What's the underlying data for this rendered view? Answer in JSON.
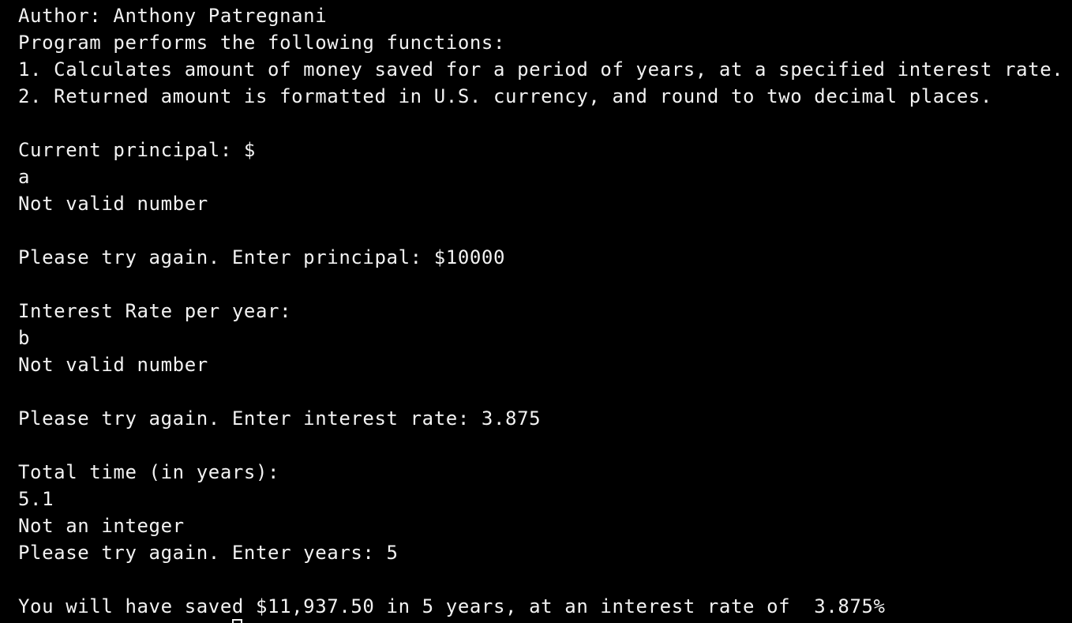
{
  "terminal": {
    "lines": [
      "Author: Anthony Patregnani",
      "Program performs the following functions:",
      "1. Calculates amount of money saved for a period of years, at a specified interest rate.",
      "2. Returned amount is formatted in U.S. currency, and round to two decimal places.",
      "",
      "Current principal: $",
      "a",
      "Not valid number",
      "",
      "Please try again. Enter principal: $10000",
      "",
      "Interest Rate per year:",
      "b",
      "Not valid number",
      "",
      "Please try again. Enter interest rate: 3.875",
      "",
      "Total time (in years):",
      "5.1",
      "Not an integer",
      "Please try again. Enter years: 5",
      "",
      "You will have saved $11,937.50 in 5 years, at an interest rate of  3.875%"
    ]
  },
  "colors": {
    "background": "#000000",
    "foreground": "#f2f2f2"
  }
}
